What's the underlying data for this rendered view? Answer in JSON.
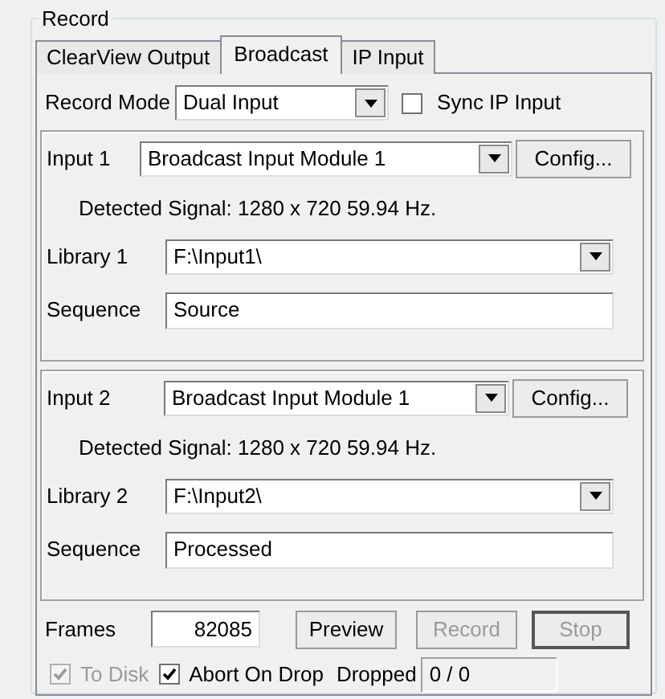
{
  "group_title": "Record",
  "tabs": [
    {
      "label": "ClearView Output",
      "selected": false
    },
    {
      "label": "Broadcast",
      "selected": true
    },
    {
      "label": "IP Input",
      "selected": false
    }
  ],
  "record_mode": {
    "label": "Record Mode",
    "value": "Dual Input"
  },
  "sync_ip_input": {
    "label": "Sync IP Input",
    "checked": false
  },
  "inputs": [
    {
      "label": "Input 1",
      "module": "Broadcast Input Module 1",
      "config_button": "Config...",
      "signal": "Detected Signal: 1280 x 720 59.94 Hz.",
      "library_label": "Library 1",
      "library": "F:\\Input1\\",
      "sequence_label": "Sequence",
      "sequence": "Source"
    },
    {
      "label": "Input 2",
      "module": "Broadcast Input Module 1",
      "config_button": "Config...",
      "signal": "Detected Signal: 1280 x 720 59.94 Hz.",
      "library_label": "Library 2",
      "library": "F:\\Input2\\",
      "sequence_label": "Sequence",
      "sequence": "Processed"
    }
  ],
  "frames": {
    "label": "Frames",
    "value": "82085"
  },
  "buttons": [
    {
      "label": "Preview",
      "disabled": false,
      "default": false
    },
    {
      "label": "Record",
      "disabled": true,
      "default": false
    },
    {
      "label": "Stop",
      "disabled": true,
      "default": true
    }
  ],
  "to_disk": {
    "label": "To Disk",
    "checked": true,
    "disabled": true
  },
  "abort_on_drop": {
    "label": "Abort On Drop",
    "checked": true,
    "disabled": false
  },
  "dropped": {
    "label": "Dropped",
    "value": "0 / 0"
  }
}
